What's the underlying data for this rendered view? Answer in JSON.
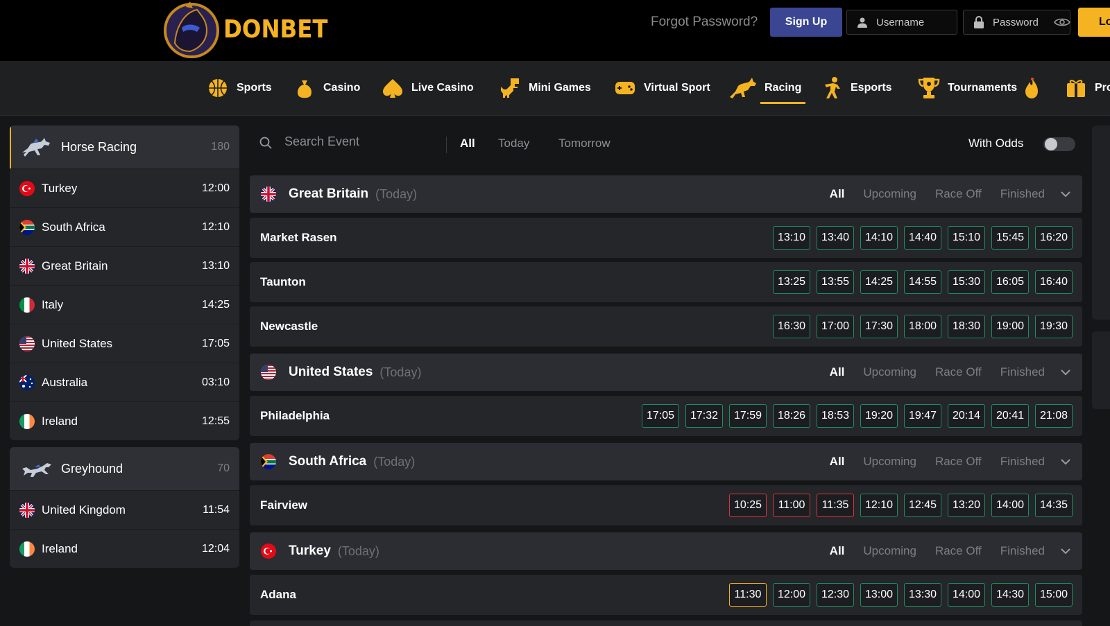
{
  "brand": {
    "name": "DONBET",
    "accent": "#f5b321"
  },
  "header": {
    "forgot_password": "Forgot Password?",
    "signup_label": "Sign Up",
    "username_placeholder": "Username",
    "password_placeholder": "Password",
    "login_label": "Lo"
  },
  "nav": {
    "items": [
      {
        "label": "Sports",
        "icon": "basketball-icon"
      },
      {
        "label": "Casino",
        "icon": "casino-bag-icon"
      },
      {
        "label": "Live Casino",
        "icon": "live-casino-icon"
      },
      {
        "label": "Mini Games",
        "icon": "dinosaur-icon"
      },
      {
        "label": "Virtual Sport",
        "icon": "gamepad-icon"
      },
      {
        "label": "Racing",
        "icon": "racing-horse-icon",
        "active": true
      },
      {
        "label": "Esports",
        "icon": "esports-player-icon"
      },
      {
        "label": "Tournaments",
        "icon": "trophy-icon"
      },
      {
        "label": "Pro",
        "icon": "promotions-icon"
      }
    ]
  },
  "sidebar": {
    "groups": [
      {
        "label": "Horse Racing",
        "count": "180",
        "icon": "horse-icon",
        "rows": [
          {
            "label": "Turkey",
            "time": "12:00",
            "flag": "turkey"
          },
          {
            "label": "South Africa",
            "time": "12:10",
            "flag": "south-africa"
          },
          {
            "label": "Great Britain",
            "time": "13:10",
            "flag": "great-britain"
          },
          {
            "label": "Italy",
            "time": "14:25",
            "flag": "italy"
          },
          {
            "label": "United States",
            "time": "17:05",
            "flag": "united-states"
          },
          {
            "label": "Australia",
            "time": "03:10",
            "flag": "australia"
          },
          {
            "label": "Ireland",
            "time": "12:55",
            "flag": "ireland"
          }
        ]
      },
      {
        "label": "Greyhound",
        "count": "70",
        "icon": "greyhound-icon",
        "rows": [
          {
            "label": "United Kingdom",
            "time": "11:54",
            "flag": "great-britain"
          },
          {
            "label": "Ireland",
            "time": "12:04",
            "flag": "ireland"
          }
        ]
      }
    ]
  },
  "main": {
    "search_placeholder": "Search Event",
    "filter_tabs": [
      "All",
      "Today",
      "Tomorrow"
    ],
    "with_odds_label": "With Odds",
    "country_tabs": [
      "All",
      "Upcoming",
      "Race Off",
      "Finished"
    ],
    "sections": [
      {
        "country": "Great Britain",
        "day": "(Today)",
        "flag": "great-britain",
        "venues": [
          {
            "name": "Market Rasen",
            "times": [
              {
                "t": "13:10",
                "s": "open"
              },
              {
                "t": "13:40",
                "s": "open"
              },
              {
                "t": "14:10",
                "s": "open"
              },
              {
                "t": "14:40",
                "s": "open"
              },
              {
                "t": "15:10",
                "s": "open"
              },
              {
                "t": "15:45",
                "s": "open"
              },
              {
                "t": "16:20",
                "s": "open"
              }
            ]
          },
          {
            "name": "Taunton",
            "times": [
              {
                "t": "13:25",
                "s": "open"
              },
              {
                "t": "13:55",
                "s": "open"
              },
              {
                "t": "14:25",
                "s": "open"
              },
              {
                "t": "14:55",
                "s": "open"
              },
              {
                "t": "15:30",
                "s": "open"
              },
              {
                "t": "16:05",
                "s": "open"
              },
              {
                "t": "16:40",
                "s": "open"
              }
            ]
          },
          {
            "name": "Newcastle",
            "times": [
              {
                "t": "16:30",
                "s": "open"
              },
              {
                "t": "17:00",
                "s": "open"
              },
              {
                "t": "17:30",
                "s": "open"
              },
              {
                "t": "18:00",
                "s": "open"
              },
              {
                "t": "18:30",
                "s": "open"
              },
              {
                "t": "19:00",
                "s": "open"
              },
              {
                "t": "19:30",
                "s": "open"
              }
            ]
          }
        ]
      },
      {
        "country": "United States",
        "day": "(Today)",
        "flag": "united-states",
        "venues": [
          {
            "name": "Philadelphia",
            "times": [
              {
                "t": "17:05",
                "s": "open"
              },
              {
                "t": "17:32",
                "s": "open"
              },
              {
                "t": "17:59",
                "s": "open"
              },
              {
                "t": "18:26",
                "s": "open"
              },
              {
                "t": "18:53",
                "s": "open"
              },
              {
                "t": "19:20",
                "s": "open"
              },
              {
                "t": "19:47",
                "s": "open"
              },
              {
                "t": "20:14",
                "s": "open"
              },
              {
                "t": "20:41",
                "s": "open"
              },
              {
                "t": "21:08",
                "s": "open"
              }
            ]
          }
        ]
      },
      {
        "country": "South Africa",
        "day": "(Today)",
        "flag": "south-africa",
        "venues": [
          {
            "name": "Fairview",
            "times": [
              {
                "t": "10:25",
                "s": "finished"
              },
              {
                "t": "11:00",
                "s": "finished"
              },
              {
                "t": "11:35",
                "s": "finished"
              },
              {
                "t": "12:10",
                "s": "open"
              },
              {
                "t": "12:45",
                "s": "open"
              },
              {
                "t": "13:20",
                "s": "open"
              },
              {
                "t": "14:00",
                "s": "open"
              },
              {
                "t": "14:35",
                "s": "open"
              }
            ]
          }
        ]
      },
      {
        "country": "Turkey",
        "day": "(Today)",
        "flag": "turkey",
        "venues": [
          {
            "name": "Adana",
            "times": [
              {
                "t": "11:30",
                "s": "live"
              },
              {
                "t": "12:00",
                "s": "open"
              },
              {
                "t": "12:30",
                "s": "open"
              },
              {
                "t": "13:00",
                "s": "open"
              },
              {
                "t": "13:30",
                "s": "open"
              },
              {
                "t": "14:00",
                "s": "open"
              },
              {
                "t": "14:30",
                "s": "open"
              },
              {
                "t": "15:00",
                "s": "open"
              }
            ]
          }
        ]
      }
    ]
  },
  "colors": {
    "open": "#1e8f5c",
    "finished": "#d9363e",
    "live": "#f5b321",
    "signup": "#3a4691"
  }
}
